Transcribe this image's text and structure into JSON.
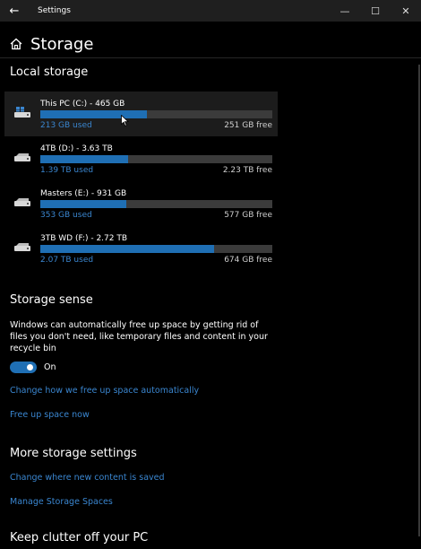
{
  "window": {
    "app_title": "Settings",
    "back_glyph": "←",
    "controls": {
      "minimize": "—",
      "maximize": "☐",
      "close": "✕"
    }
  },
  "header": {
    "title": "Storage",
    "icon": "home-icon"
  },
  "local_storage": {
    "heading": "Local storage",
    "drives": [
      {
        "name": "This PC (C:) - 465 GB",
        "used": "213 GB used",
        "free": "251 GB free",
        "used_fraction": 0.46,
        "icon": "windows-drive-icon",
        "selected": true
      },
      {
        "name": "4TB (D:) - 3.63 TB",
        "used": "1.39 TB used",
        "free": "2.23 TB free",
        "used_fraction": 0.38,
        "icon": "drive-icon",
        "selected": false
      },
      {
        "name": "Masters (E:) - 931 GB",
        "used": "353 GB used",
        "free": "577 GB free",
        "used_fraction": 0.37,
        "icon": "drive-icon",
        "selected": false
      },
      {
        "name": "3TB WD (F:) - 2.72 TB",
        "used": "2.07 TB used",
        "free": "674 GB free",
        "used_fraction": 0.75,
        "icon": "drive-icon",
        "selected": false
      }
    ]
  },
  "storage_sense": {
    "heading": "Storage sense",
    "description": "Windows can automatically free up space by getting rid of files you don't need, like temporary files and content in your recycle bin",
    "toggle_state": "On",
    "links": [
      "Change how we free up space automatically",
      "Free up space now"
    ]
  },
  "more_settings": {
    "heading": "More storage settings",
    "links": [
      "Change where new content is saved",
      "Manage Storage Spaces"
    ]
  },
  "keep_clutter": {
    "heading": "Keep clutter off your PC"
  },
  "colors": {
    "accent": "#1f6fb4",
    "link": "#3a86d0",
    "bar_track": "#3b3b3b",
    "background": "#000000"
  }
}
